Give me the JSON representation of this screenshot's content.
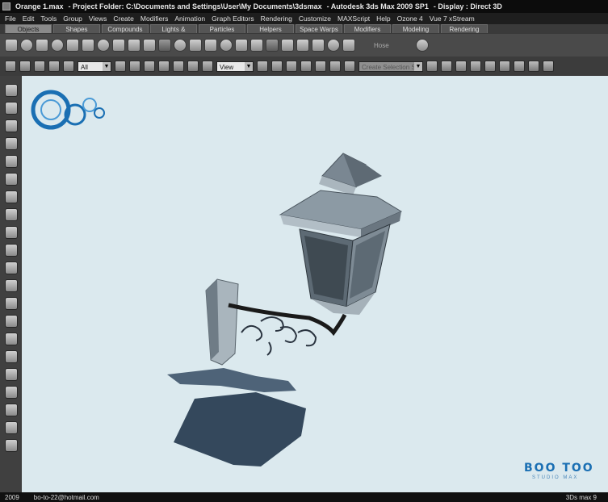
{
  "window": {
    "file": "Orange 1.max",
    "project": "- Project Folder: C:\\Documents and Settings\\User\\My Documents\\3dsmax",
    "app": "- Autodesk 3ds Max  2009 SP1",
    "display": "- Display : Direct 3D"
  },
  "menu": [
    "File",
    "Edit",
    "Tools",
    "Group",
    "Views",
    "Create",
    "Modifiers",
    "Animation",
    "Graph Editors",
    "Rendering",
    "Customize",
    "MAXScript",
    "Help",
    "Ozone 4",
    "Vue 7 xStream"
  ],
  "tabs": [
    "Objects",
    "Shapes",
    "Compounds",
    "Lights & Cameras",
    "Particles",
    "Helpers",
    "Space Warps",
    "Modifiers",
    "Modeling",
    "Rendering"
  ],
  "active_tab": "Objects",
  "shelf": {
    "hose_label": "Hose"
  },
  "toolbar": {
    "selection_filter": "All",
    "reference_coord": "View",
    "named_selection_placeholder": "Create Selection Se"
  },
  "logo": {
    "name": "BOO TOO",
    "sub": "STUDIO MAX",
    "color": "#1a6fb3"
  },
  "status": {
    "year": "2009",
    "email": "bo-to-22@hotmail.com",
    "version": "3Ds max 9"
  },
  "colors": {
    "viewport_bg": "#dbe9ee",
    "lamp": "#8c9aa4",
    "shadow": "#34485c"
  }
}
